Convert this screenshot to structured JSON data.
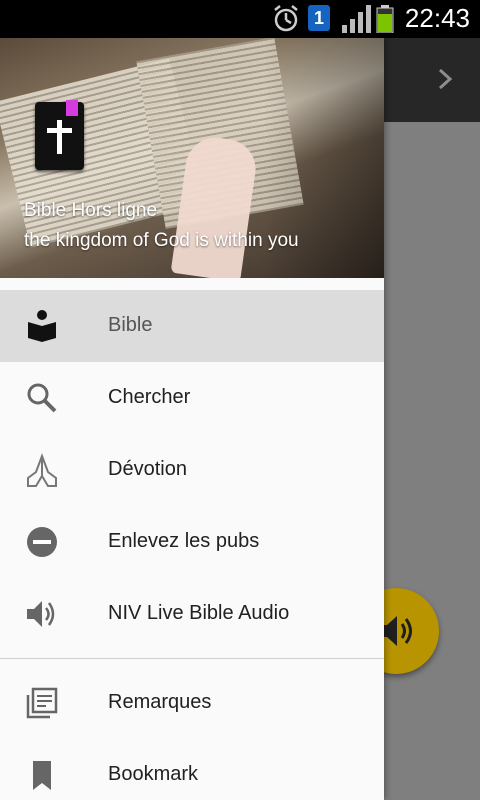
{
  "status_bar": {
    "time": "22:43",
    "notification_badge": "1",
    "icons": [
      "alarm-icon",
      "notification-icon",
      "signal-icon",
      "battery-icon"
    ]
  },
  "header": {
    "title": "Bible Hors ligne",
    "subtitle": "the kingdom of God is within you"
  },
  "menu": {
    "items": [
      {
        "label": "Bible",
        "icon": "bible-reader-icon",
        "selected": true
      },
      {
        "label": "Chercher",
        "icon": "search-icon"
      },
      {
        "label": "Dévotion",
        "icon": "praying-hands-icon"
      },
      {
        "label": "Enlevez les pubs",
        "icon": "remove-circle-icon"
      },
      {
        "label": "NIV Live Bible Audio",
        "icon": "volume-icon"
      }
    ],
    "items2": [
      {
        "label": "Remarques",
        "icon": "notes-icon"
      },
      {
        "label": "Bookmark",
        "icon": "bookmark-icon"
      }
    ]
  },
  "colors": {
    "fab": "#c8a200",
    "selected_bg": "#dcdcdc",
    "brand_tab": "#d63be0"
  }
}
